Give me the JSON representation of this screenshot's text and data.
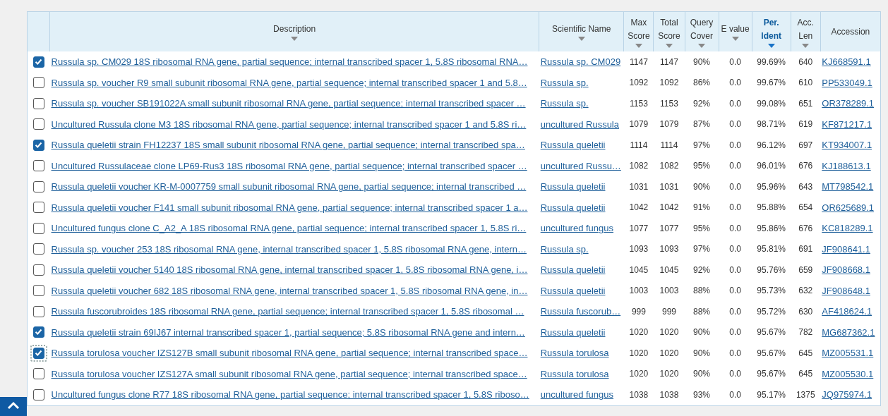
{
  "table": {
    "columns": [
      {
        "label": "Description",
        "sortable": true,
        "sorted": false
      },
      {
        "label": "Scientific Name",
        "sortable": true,
        "sorted": false
      },
      {
        "label": "Max Score",
        "sortable": true,
        "sorted": false
      },
      {
        "label": "Total Score",
        "sortable": true,
        "sorted": false
      },
      {
        "label": "Query Cover",
        "sortable": true,
        "sorted": false
      },
      {
        "label": "E value",
        "sortable": true,
        "sorted": false
      },
      {
        "label": "Per. Ident",
        "sortable": true,
        "sorted": true
      },
      {
        "label": "Acc. Len",
        "sortable": true,
        "sorted": false
      },
      {
        "label": "Accession",
        "sortable": false,
        "sorted": false
      }
    ],
    "rows": [
      {
        "checked": true,
        "focused": false,
        "description": "Russula sp. CM029 18S ribosomal RNA gene, partial sequence; internal transcribed spacer 1, 5.8S ribosomal RNA…",
        "scientific_name": "Russula sp. CM029",
        "max_score": "1147",
        "total_score": "1147",
        "query_cover": "90%",
        "e_value": "0.0",
        "per_ident": "99.69%",
        "acc_len": "640",
        "accession": "KJ668591.1"
      },
      {
        "checked": false,
        "focused": false,
        "description": "Russula sp. voucher R9 small subunit ribosomal RNA gene, partial sequence; internal transcribed spacer 1 and 5.8…",
        "scientific_name": "Russula sp.",
        "max_score": "1092",
        "total_score": "1092",
        "query_cover": "86%",
        "e_value": "0.0",
        "per_ident": "99.67%",
        "acc_len": "610",
        "accession": "PP533049.1"
      },
      {
        "checked": false,
        "focused": false,
        "description": "Russula sp. voucher SB191022A small subunit ribosomal RNA gene, partial sequence; internal transcribed spacer …",
        "scientific_name": "Russula sp.",
        "max_score": "1153",
        "total_score": "1153",
        "query_cover": "92%",
        "e_value": "0.0",
        "per_ident": "99.08%",
        "acc_len": "651",
        "accession": "OR378289.1"
      },
      {
        "checked": false,
        "focused": false,
        "description": "Uncultured Russula clone M3 18S ribosomal RNA gene, partial sequence; internal transcribed spacer 1 and 5.8S ri…",
        "scientific_name": "uncultured Russula",
        "max_score": "1079",
        "total_score": "1079",
        "query_cover": "87%",
        "e_value": "0.0",
        "per_ident": "98.71%",
        "acc_len": "619",
        "accession": "KF871217.1"
      },
      {
        "checked": true,
        "focused": false,
        "description": "Russula queletii strain FH12237 18S small subunit ribosomal RNA gene, partial sequence; internal transcribed spa…",
        "scientific_name": "Russula queletii",
        "max_score": "1114",
        "total_score": "1114",
        "query_cover": "97%",
        "e_value": "0.0",
        "per_ident": "96.12%",
        "acc_len": "697",
        "accession": "KT934007.1"
      },
      {
        "checked": false,
        "focused": false,
        "description": "Uncultured Russulaceae clone LP69-Rus3 18S ribosomal RNA gene, partial sequence; internal transcribed spacer …",
        "scientific_name": "uncultured Russu…",
        "max_score": "1082",
        "total_score": "1082",
        "query_cover": "95%",
        "e_value": "0.0",
        "per_ident": "96.01%",
        "acc_len": "676",
        "accession": "KJ188613.1"
      },
      {
        "checked": false,
        "focused": false,
        "description": "Russula queletii voucher KR-M-0007759 small subunit ribosomal RNA gene, partial sequence; internal transcribed …",
        "scientific_name": "Russula queletii",
        "max_score": "1031",
        "total_score": "1031",
        "query_cover": "90%",
        "e_value": "0.0",
        "per_ident": "95.96%",
        "acc_len": "643",
        "accession": "MT798542.1"
      },
      {
        "checked": false,
        "focused": false,
        "description": "Russula queletii voucher F141 small subunit ribosomal RNA gene, partial sequence; internal transcribed spacer 1 a…",
        "scientific_name": "Russula queletii",
        "max_score": "1042",
        "total_score": "1042",
        "query_cover": "91%",
        "e_value": "0.0",
        "per_ident": "95.88%",
        "acc_len": "654",
        "accession": "OR625689.1"
      },
      {
        "checked": false,
        "focused": false,
        "description": "Uncultured fungus clone C_A2_A 18S ribosomal RNA gene, partial sequence; internal transcribed spacer 1, 5.8S ri…",
        "scientific_name": "uncultured fungus",
        "max_score": "1077",
        "total_score": "1077",
        "query_cover": "95%",
        "e_value": "0.0",
        "per_ident": "95.86%",
        "acc_len": "676",
        "accession": "KC818289.1"
      },
      {
        "checked": false,
        "focused": false,
        "description": "Russula sp. voucher 253 18S ribosomal RNA gene, internal transcribed spacer 1, 5.8S ribosomal RNA gene, intern…",
        "scientific_name": "Russula sp.",
        "max_score": "1093",
        "total_score": "1093",
        "query_cover": "97%",
        "e_value": "0.0",
        "per_ident": "95.81%",
        "acc_len": "691",
        "accession": "JF908641.1"
      },
      {
        "checked": false,
        "focused": false,
        "description": "Russula queletii voucher 5140 18S ribosomal RNA gene, internal transcribed spacer 1, 5.8S ribosomal RNA gene, i…",
        "scientific_name": "Russula queletii",
        "max_score": "1045",
        "total_score": "1045",
        "query_cover": "92%",
        "e_value": "0.0",
        "per_ident": "95.76%",
        "acc_len": "659",
        "accession": "JF908668.1"
      },
      {
        "checked": false,
        "focused": false,
        "description": "Russula queletii voucher 682 18S ribosomal RNA gene, internal transcribed spacer 1, 5.8S ribosomal RNA gene, in…",
        "scientific_name": "Russula queletii",
        "max_score": "1003",
        "total_score": "1003",
        "query_cover": "88%",
        "e_value": "0.0",
        "per_ident": "95.73%",
        "acc_len": "632",
        "accession": "JF908648.1"
      },
      {
        "checked": false,
        "focused": false,
        "description": "Russula fuscorubroides 18S ribosomal RNA gene, partial sequence; internal transcribed spacer 1, 5.8S ribosomal …",
        "scientific_name": "Russula fuscorub…",
        "max_score": "999",
        "total_score": "999",
        "query_cover": "88%",
        "e_value": "0.0",
        "per_ident": "95.72%",
        "acc_len": "630",
        "accession": "AF418624.1"
      },
      {
        "checked": true,
        "focused": false,
        "description": "Russula queletii strain 69IJ67 internal transcribed spacer 1, partial sequence; 5.8S ribosomal RNA gene and intern…",
        "scientific_name": "Russula queletii",
        "max_score": "1020",
        "total_score": "1020",
        "query_cover": "90%",
        "e_value": "0.0",
        "per_ident": "95.67%",
        "acc_len": "782",
        "accession": "MG687362.1"
      },
      {
        "checked": true,
        "focused": true,
        "description": "Russula torulosa voucher IZS127B small subunit ribosomal RNA gene, partial sequence; internal transcribed space…",
        "scientific_name": "Russula torulosa",
        "max_score": "1020",
        "total_score": "1020",
        "query_cover": "90%",
        "e_value": "0.0",
        "per_ident": "95.67%",
        "acc_len": "645",
        "accession": "MZ005531.1"
      },
      {
        "checked": false,
        "focused": false,
        "description": "Russula torulosa voucher IZS127A small subunit ribosomal RNA gene, partial sequence; internal transcribed space…",
        "scientific_name": "Russula torulosa",
        "max_score": "1020",
        "total_score": "1020",
        "query_cover": "90%",
        "e_value": "0.0",
        "per_ident": "95.67%",
        "acc_len": "645",
        "accession": "MZ005530.1"
      },
      {
        "checked": false,
        "focused": false,
        "description": "Uncultured fungus clone R77 18S ribosomal RNA gene, partial sequence; internal transcribed spacer 1, 5.8S riboso…",
        "scientific_name": "uncultured fungus",
        "max_score": "1038",
        "total_score": "1038",
        "query_cover": "93%",
        "e_value": "0.0",
        "per_ident": "95.17%",
        "acc_len": "1375",
        "accession": "JQ975974.1"
      }
    ]
  }
}
